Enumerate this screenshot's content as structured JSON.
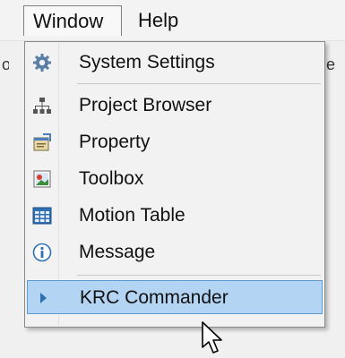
{
  "menubar": {
    "items": [
      {
        "label": "Window"
      },
      {
        "label": "Help"
      }
    ]
  },
  "window_menu": {
    "items": [
      {
        "label": "System Settings",
        "icon": "gear-icon"
      },
      {
        "label": "Project Browser",
        "icon": "hierarchy-icon"
      },
      {
        "label": "Property",
        "icon": "property-icon"
      },
      {
        "label": "Toolbox",
        "icon": "toolbox-icon"
      },
      {
        "label": "Motion Table",
        "icon": "table-icon"
      },
      {
        "label": "Message",
        "icon": "info-icon"
      },
      {
        "label": "KRC Commander",
        "icon": "play-arrow-icon",
        "highlighted": true
      }
    ]
  },
  "colors": {
    "highlight": "#b3d4f2",
    "highlight_border": "#5b9bd5",
    "menu_background": "#f2f2f2"
  },
  "background_peek": {
    "left_text": "o",
    "right_text": "e"
  }
}
